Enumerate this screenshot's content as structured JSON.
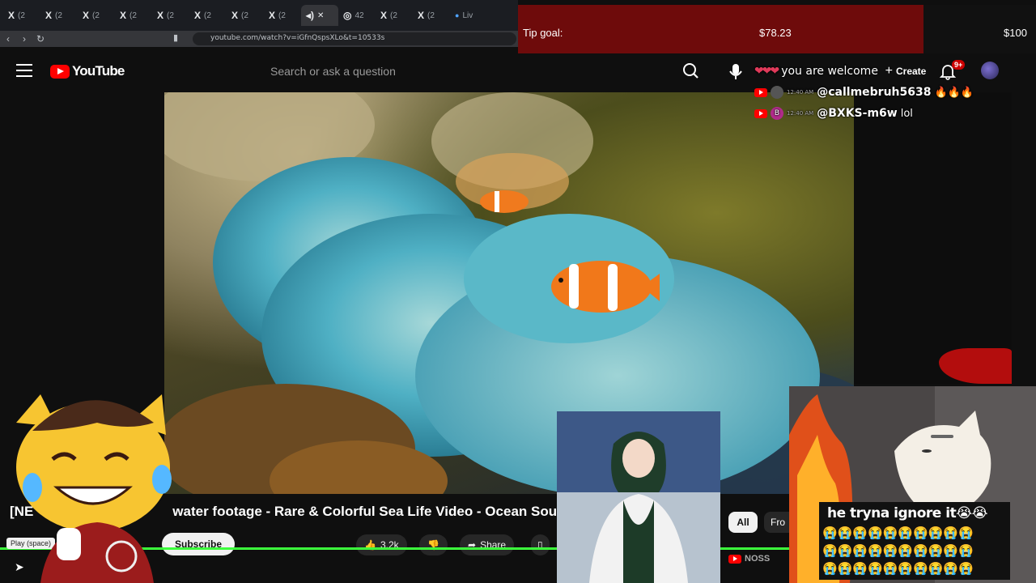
{
  "browser": {
    "tabs": [
      {
        "icon": "x-icon",
        "label": "X",
        "count": "(2"
      },
      {
        "icon": "x-icon",
        "label": "X",
        "count": "(2"
      },
      {
        "icon": "x-icon",
        "label": "X",
        "count": "(2"
      },
      {
        "icon": "x-icon",
        "label": "X",
        "count": "(2"
      },
      {
        "icon": "x-icon",
        "label": "X",
        "count": "(2"
      },
      {
        "icon": "x-icon",
        "label": "X",
        "count": "(2"
      },
      {
        "icon": "x-icon",
        "label": "X",
        "count": "(2"
      },
      {
        "icon": "x-icon",
        "label": "X",
        "count": "(2"
      },
      {
        "icon": "audio-icon",
        "label": "◂)",
        "count": ""
      },
      {
        "icon": "globe-icon",
        "label": "◎",
        "count": "42"
      },
      {
        "icon": "x-icon",
        "label": "X",
        "count": "(2"
      },
      {
        "icon": "x-icon",
        "label": "X",
        "count": "(2"
      },
      {
        "icon": "live-icon",
        "label": "●",
        "count": "Liv"
      }
    ],
    "url": "youtube.com/watch?v=iGfnQspsXLo&t=10533s"
  },
  "tip_goal": {
    "label": "Tip goal:",
    "current": "$78.23",
    "goal": "$100",
    "progress": 0.7823,
    "fill_color": "#6e0b0b"
  },
  "youtube": {
    "logo_text": "YouTube",
    "search_placeholder": "Search or ask a question",
    "create_label": "Create",
    "notif_badge": "9+",
    "video_title_start": "[NE",
    "video_title": "water footage - Rare & Colorful Sea Life Video - Ocean Soun",
    "subscribe_label": "Subscribe",
    "like_count": "3.2k",
    "share_label": "Share",
    "chip_all": "All",
    "chip_from": "Fro",
    "channel_partial": "NOSS",
    "tooltip": "Play (space)"
  },
  "chat": [
    {
      "time": "",
      "user": "",
      "message": "you are welcome"
    },
    {
      "time": "12:40 AM",
      "user": "@callmebruh5638",
      "message": "🔥🔥🔥"
    },
    {
      "time": "12:40 AM",
      "user": "@BXKS-m6w",
      "message": "lol"
    }
  ],
  "overlay": {
    "caption": "he tryna ignore it",
    "emoji": "😭"
  },
  "colors": {
    "progress_green": "#3cff3c",
    "youtube_red": "#ff0000"
  }
}
